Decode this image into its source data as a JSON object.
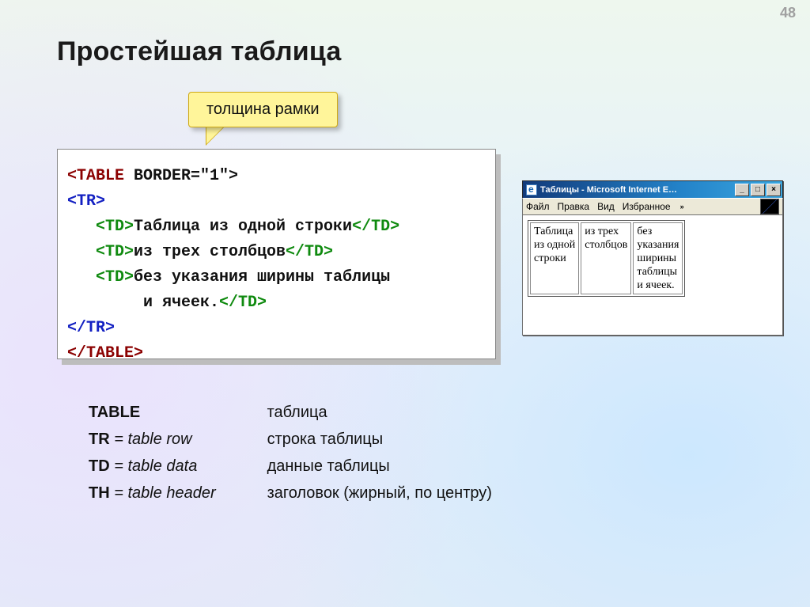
{
  "page_number": "48",
  "title": "Простейшая таблица",
  "callout": "толщина рамки",
  "code": {
    "l1_open": "<TABLE",
    "l1_attr": " BORDER=\"1\">",
    "l2": "<TR>",
    "l3_open": "   <TD>",
    "l3_text": "Таблица из одной строки",
    "l3_close": "</TD>",
    "l4_open": "   <TD>",
    "l4_text": "из трех столбцов",
    "l4_close": "</TD>",
    "l5_open": "   <TD>",
    "l5_text": "без указания ширины таблицы",
    "l6_text": "        и ячеек.",
    "l6_close": "</TD>",
    "l7": "</TR>",
    "l8": "</TABLE>"
  },
  "glossary": [
    {
      "key_bold": "TABLE",
      "key_rest": "",
      "val": "таблица"
    },
    {
      "key_bold": "TR",
      "key_rest": " = table row",
      "val": "строка таблицы"
    },
    {
      "key_bold": "TD",
      "key_rest": " = table data",
      "val": "данные таблицы"
    },
    {
      "key_bold": "TH",
      "key_rest": " = table header",
      "val": "заголовок (жирный, по центру)"
    }
  ],
  "ie_window": {
    "title": "Таблицы - Microsoft Internet E…",
    "menu": [
      "Файл",
      "Правка",
      "Вид",
      "Избранное"
    ],
    "chevron": "»",
    "btn_min": "_",
    "btn_max": "□",
    "btn_close": "×",
    "cells": [
      "Таблица\nиз одной\nстроки",
      "из трех\nстолбцов",
      "без\nуказания\nширины\nтаблицы\nи ячеек."
    ]
  }
}
